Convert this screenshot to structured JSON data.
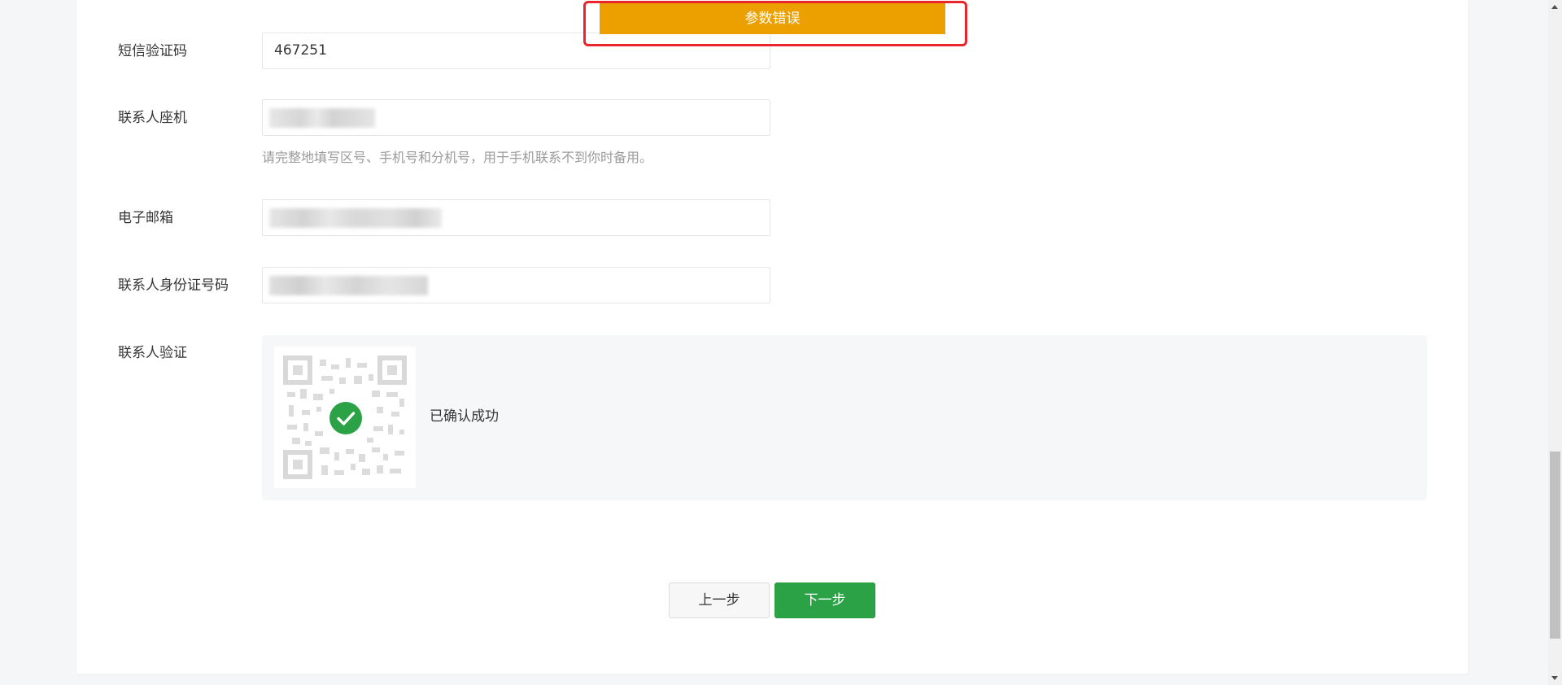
{
  "toast": {
    "message": "参数错误"
  },
  "form": {
    "sms_code": {
      "label": "短信验证码",
      "value": "467251"
    },
    "landline": {
      "label": "联系人座机",
      "hint": "请完整地填写区号、手机号和分机号，用于手机联系不到你时备用。"
    },
    "email": {
      "label": "电子邮箱"
    },
    "id_number": {
      "label": "联系人身份证号码"
    },
    "contact_verify": {
      "label": "联系人验证",
      "status_text": "已确认成功"
    }
  },
  "buttons": {
    "prev_label": "上一步",
    "next_label": "下一步"
  },
  "colors": {
    "toast_bg": "#eba000",
    "toast_outline": "#e8262b",
    "primary_green": "#2ba245",
    "hint_gray": "#9a9a9a"
  },
  "icons": {
    "qr_code": "qr-code-icon",
    "check": "check-circle-icon"
  }
}
